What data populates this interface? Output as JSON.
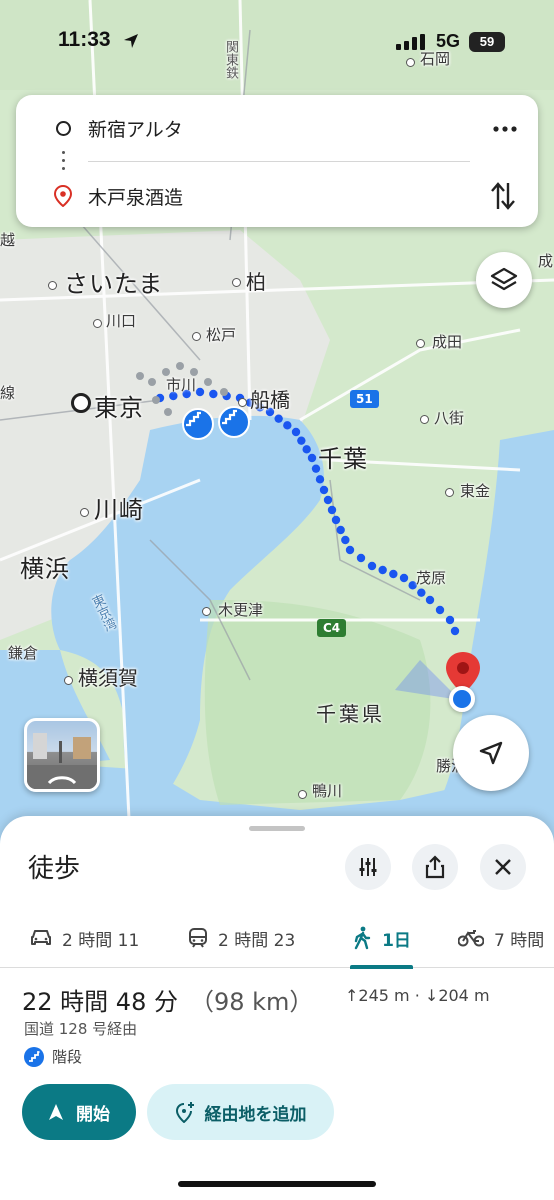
{
  "status_bar": {
    "time": "11:33",
    "network": "5G",
    "battery": "59"
  },
  "directions": {
    "origin": "新宿アルタ",
    "destination": "木戸泉酒造"
  },
  "map": {
    "labels": {
      "ishioka": "石岡",
      "kanto_railway": "関東鉄",
      "saitama": "さいたま",
      "kashiwa": "柏",
      "kawaguchi": "川口",
      "matsudo": "松戸",
      "narita": "成田",
      "ichikawa": "市川",
      "funabashi": "船橋",
      "tokyo": "東京",
      "yachimata": "八街",
      "chiba": "千葉",
      "togane": "東金",
      "kawasaki": "川崎",
      "yokohama": "横浜",
      "mobara": "茂原",
      "tokyo_bay": "東京湾",
      "kisarazu": "木更津",
      "kamakura": "鎌倉",
      "yokosuka": "横須賀",
      "chiba_pref": "千葉県",
      "katsuura": "勝浦",
      "kamogawa": "鴨川",
      "left_edge": "越",
      "left_edge2": "線",
      "right_edge": "成"
    },
    "shields": {
      "route51": "51",
      "c4": "C4"
    },
    "colors": {
      "route": "#1a56f0",
      "water": "#a8d3f2",
      "land": "#cfe8c8",
      "pin": "#e53935"
    }
  },
  "sheet": {
    "mode_title": "徒歩",
    "tabs": [
      {
        "icon": "car-icon",
        "label": "2 時間 11"
      },
      {
        "icon": "train-icon",
        "label": "2 時間 23"
      },
      {
        "icon": "walk-icon",
        "label": "1日"
      },
      {
        "icon": "bicycle-icon",
        "label": "7 時間"
      }
    ],
    "duration": "22 時間 48 分",
    "distance": "（98 km）",
    "elevation_up": "245 m",
    "elevation_sep": "·",
    "elevation_down": "204 m",
    "via": "国道 128 号経由",
    "stairs_label": "階段",
    "start_label": "開始",
    "add_stop_label": "経由地を追加"
  }
}
